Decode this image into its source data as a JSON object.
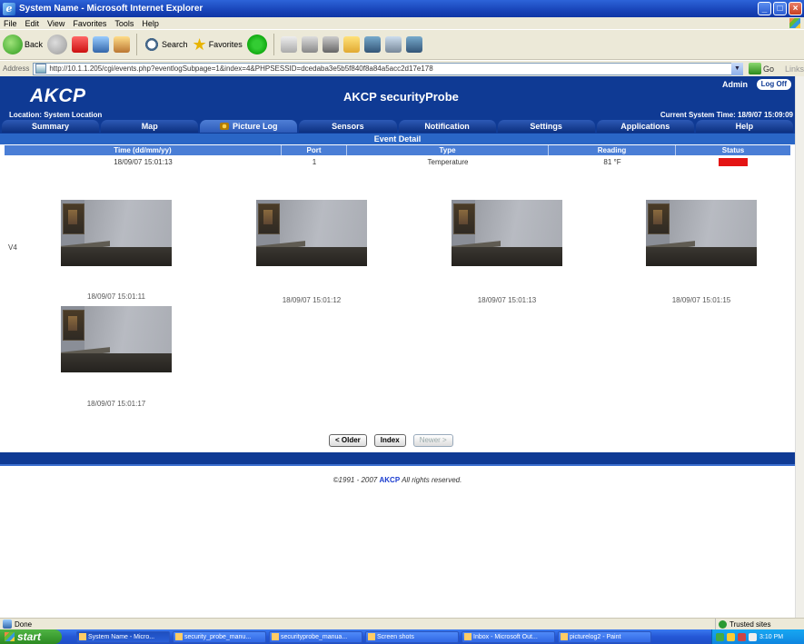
{
  "window": {
    "title": "System Name - Microsoft Internet Explorer"
  },
  "menu": [
    "File",
    "Edit",
    "View",
    "Favorites",
    "Tools",
    "Help"
  ],
  "toolbar": {
    "back": "Back",
    "search": "Search",
    "favorites": "Favorites"
  },
  "address": {
    "label": "Address",
    "url": "http://10.1.1.205/cgi/events.php?eventlogSubpage=1&index=4&PHPSESSID=dcedaba3e5b5f840f8a84a5acc2d17e178",
    "go": "Go",
    "links": "Links"
  },
  "app": {
    "logo": "AKCP",
    "product": "AKCP securityProbe",
    "user": "Admin",
    "logoff": "Log Off",
    "location": "Location: System Location",
    "system_time": "Current System Time: 18/9/07 15:09:09"
  },
  "tabs": [
    {
      "label": "Summary",
      "active": false
    },
    {
      "label": "Map",
      "active": false
    },
    {
      "label": "Picture Log",
      "active": true
    },
    {
      "label": "Sensors",
      "active": false
    },
    {
      "label": "Notification",
      "active": false
    },
    {
      "label": "Settings",
      "active": false
    },
    {
      "label": "Applications",
      "active": false
    },
    {
      "label": "Help",
      "active": false
    }
  ],
  "event": {
    "section_title": "Event Detail",
    "columns": [
      "Time (dd/mm/yy)",
      "Port",
      "Type",
      "Reading",
      "Status"
    ],
    "row": {
      "time": "18/09/07 15:01:13",
      "port": "1",
      "type": "Temperature",
      "reading": "81 °F",
      "status": "Critical",
      "status_color": "#e41414"
    },
    "camera_label": "V4",
    "pictures": [
      {
        "caption": "18/09/07 15:01:11"
      },
      {
        "caption": "18/09/07 15:01:12"
      },
      {
        "caption": "18/09/07 15:01:13"
      },
      {
        "caption": "18/09/07 15:01:15"
      },
      {
        "caption": "18/09/07 15:01:17"
      }
    ]
  },
  "nav": {
    "older": "< Older",
    "index": "Index",
    "newer": "Newer >"
  },
  "footer": {
    "prefix": "©1991 - 2007 ",
    "brand": "AKCP",
    "suffix": " All rights reserved."
  },
  "statusbar": {
    "text": "Done",
    "zone": "Trusted sites"
  },
  "taskbar": {
    "start": "start",
    "tasks": [
      "System Name - Micro...",
      "security_probe_manu...",
      "securityprobe_manua...",
      "Screen shots",
      "Inbox - Microsoft Out...",
      "picturelog2 - Paint"
    ],
    "clock": "3:10 PM"
  },
  "colors": {
    "header_blue": "#0f3a94",
    "band_blue": "#2a66c6",
    "critical": "#e41414"
  }
}
